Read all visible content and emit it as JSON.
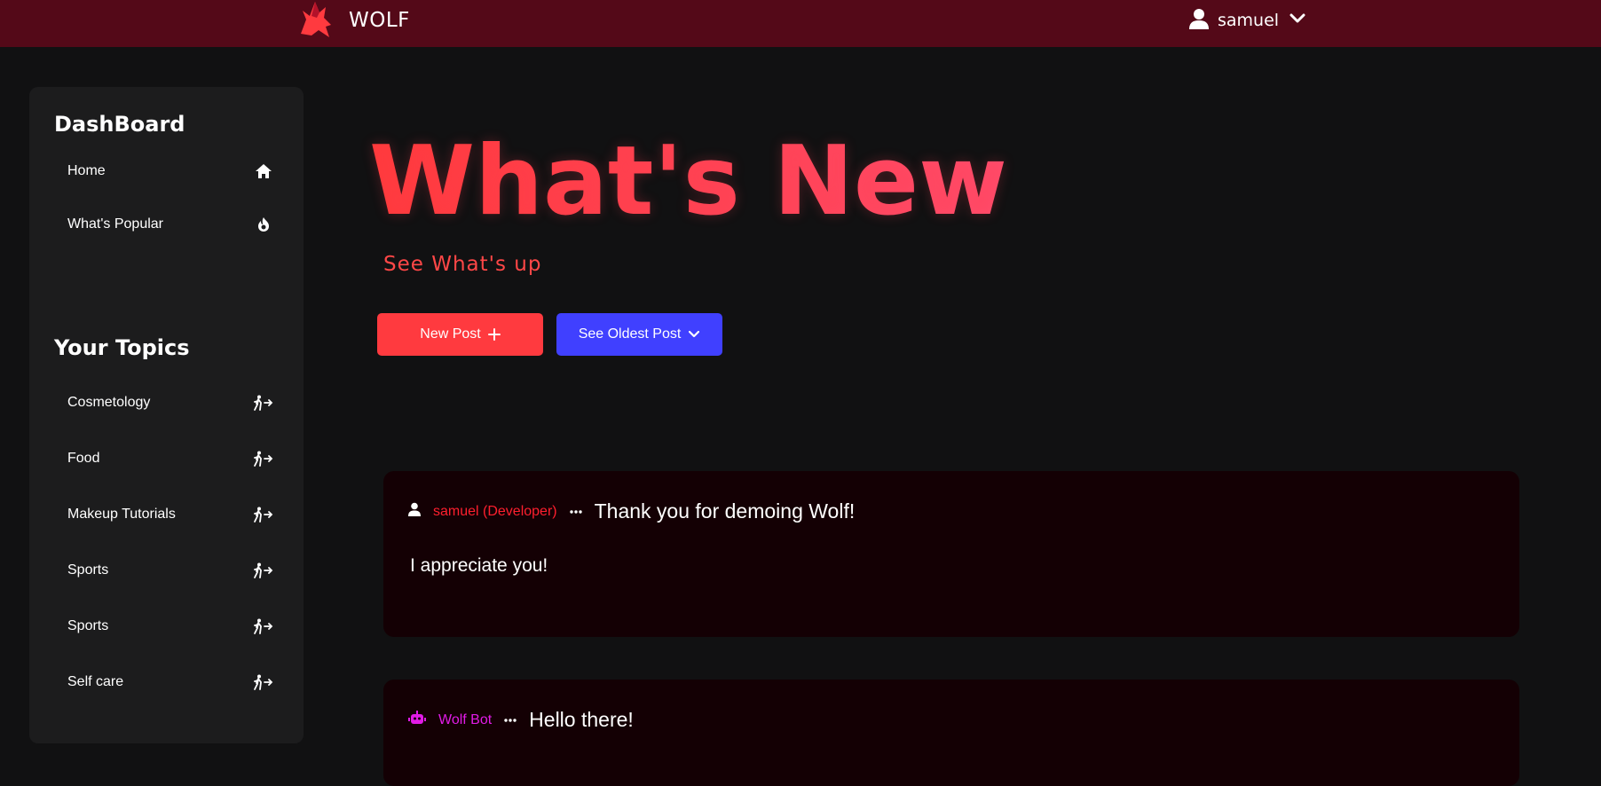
{
  "header": {
    "brand_name": "WOLF",
    "username": "samuel"
  },
  "sidebar": {
    "dashboard_heading": "DashBoard",
    "dashboard_items": [
      {
        "label": "Home",
        "icon": "home-icon"
      },
      {
        "label": "What's  Popular",
        "icon": "fire-icon"
      }
    ],
    "topics_heading": "Your Topics",
    "topics": [
      {
        "label": "Cosmetology",
        "icon": "walk-in-icon"
      },
      {
        "label": "Food",
        "icon": "walk-in-icon"
      },
      {
        "label": "Makeup Tutorials",
        "icon": "walk-in-icon"
      },
      {
        "label": "Sports",
        "icon": "walk-in-icon"
      },
      {
        "label": "Sports",
        "icon": "walk-in-icon"
      },
      {
        "label": "Self care",
        "icon": "walk-in-icon"
      }
    ]
  },
  "main": {
    "title": "What's New",
    "subtitle": "See What's up",
    "new_post_label": "New Post",
    "oldest_post_label": "See Oldest Post"
  },
  "posts": [
    {
      "author": "samuel (Developer)",
      "author_color": "#ff1f2e",
      "title": "Thank you for demoing Wolf!",
      "body": "I appreciate you!",
      "icon": "user-icon"
    },
    {
      "author": "Wolf Bot",
      "author_color": "#e11be6",
      "title": "Hello there!",
      "body": "",
      "icon": "robot-icon"
    }
  ],
  "colors": {
    "topbar": "#540918",
    "background": "#111112",
    "sidebar": "#1c1c1d",
    "accent_red": "#ff3a3f",
    "accent_blue": "#4040ff",
    "post_bg": "#140004"
  }
}
